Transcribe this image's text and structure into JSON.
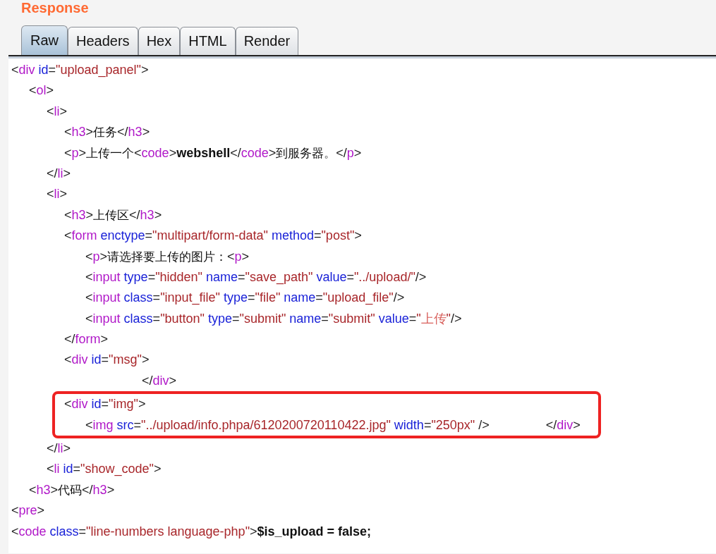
{
  "title": "Response",
  "tabs": [
    {
      "label": "Raw",
      "selected": true
    },
    {
      "label": "Headers",
      "selected": false
    },
    {
      "label": "Hex",
      "selected": false
    },
    {
      "label": "HTML",
      "selected": false
    },
    {
      "label": "Render",
      "selected": false
    }
  ],
  "code_lines": [
    {
      "highlighted": false,
      "segments": [
        {
          "kind": "p",
          "text": "<"
        },
        {
          "kind": "tag",
          "text": "div"
        },
        {
          "kind": "attr",
          "text": " id"
        },
        {
          "kind": "p",
          "text": "="
        },
        {
          "kind": "val",
          "text": "\"upload_panel\""
        },
        {
          "kind": "p",
          "text": ">"
        }
      ]
    },
    {
      "highlighted": false,
      "segments": [
        {
          "kind": "p",
          "text": "     <"
        },
        {
          "kind": "tag",
          "text": "ol"
        },
        {
          "kind": "p",
          "text": ">"
        }
      ]
    },
    {
      "highlighted": false,
      "segments": [
        {
          "kind": "p",
          "text": "          <"
        },
        {
          "kind": "tag",
          "text": "li"
        },
        {
          "kind": "p",
          "text": ">"
        }
      ]
    },
    {
      "highlighted": false,
      "segments": [
        {
          "kind": "p",
          "text": "               <"
        },
        {
          "kind": "tag",
          "text": "h3"
        },
        {
          "kind": "p",
          "text": ">"
        },
        {
          "kind": "text",
          "text": "任务"
        },
        {
          "kind": "p",
          "text": "</"
        },
        {
          "kind": "tag",
          "text": "h3"
        },
        {
          "kind": "p",
          "text": ">"
        }
      ]
    },
    {
      "highlighted": false,
      "segments": [
        {
          "kind": "p",
          "text": "               <"
        },
        {
          "kind": "tag",
          "text": "p"
        },
        {
          "kind": "p",
          "text": ">"
        },
        {
          "kind": "text",
          "text": "上传一个"
        },
        {
          "kind": "p",
          "text": "<"
        },
        {
          "kind": "tag",
          "text": "code"
        },
        {
          "kind": "p",
          "text": ">"
        },
        {
          "kind": "bold",
          "text": "webshell"
        },
        {
          "kind": "p",
          "text": "</"
        },
        {
          "kind": "tag",
          "text": "code"
        },
        {
          "kind": "p",
          "text": ">"
        },
        {
          "kind": "text",
          "text": "到服务器。"
        },
        {
          "kind": "p",
          "text": "</"
        },
        {
          "kind": "tag",
          "text": "p"
        },
        {
          "kind": "p",
          "text": ">"
        }
      ]
    },
    {
      "highlighted": false,
      "segments": [
        {
          "kind": "p",
          "text": "          </"
        },
        {
          "kind": "tag",
          "text": "li"
        },
        {
          "kind": "p",
          "text": ">"
        }
      ]
    },
    {
      "highlighted": false,
      "segments": [
        {
          "kind": "p",
          "text": "          <"
        },
        {
          "kind": "tag",
          "text": "li"
        },
        {
          "kind": "p",
          "text": ">"
        }
      ]
    },
    {
      "highlighted": false,
      "segments": [
        {
          "kind": "p",
          "text": "               <"
        },
        {
          "kind": "tag",
          "text": "h3"
        },
        {
          "kind": "p",
          "text": ">"
        },
        {
          "kind": "text",
          "text": "上传区"
        },
        {
          "kind": "p",
          "text": "</"
        },
        {
          "kind": "tag",
          "text": "h3"
        },
        {
          "kind": "p",
          "text": ">"
        }
      ]
    },
    {
      "highlighted": false,
      "segments": [
        {
          "kind": "p",
          "text": "               <"
        },
        {
          "kind": "tag",
          "text": "form"
        },
        {
          "kind": "attr",
          "text": " enctype"
        },
        {
          "kind": "p",
          "text": "="
        },
        {
          "kind": "val",
          "text": "\"multipart/form-data\""
        },
        {
          "kind": "attr",
          "text": " method"
        },
        {
          "kind": "p",
          "text": "="
        },
        {
          "kind": "val",
          "text": "\"post\""
        },
        {
          "kind": "p",
          "text": ">"
        }
      ]
    },
    {
      "highlighted": false,
      "segments": [
        {
          "kind": "p",
          "text": "                     <"
        },
        {
          "kind": "tag",
          "text": "p"
        },
        {
          "kind": "p",
          "text": ">"
        },
        {
          "kind": "text",
          "text": "请选择要上传的图片："
        },
        {
          "kind": "p",
          "text": "<"
        },
        {
          "kind": "tag",
          "text": "p"
        },
        {
          "kind": "p",
          "text": ">"
        }
      ]
    },
    {
      "highlighted": false,
      "segments": [
        {
          "kind": "p",
          "text": "                     <"
        },
        {
          "kind": "tag",
          "text": "input"
        },
        {
          "kind": "attr",
          "text": " type"
        },
        {
          "kind": "p",
          "text": "="
        },
        {
          "kind": "val",
          "text": "\"hidden\""
        },
        {
          "kind": "attr",
          "text": " name"
        },
        {
          "kind": "p",
          "text": "="
        },
        {
          "kind": "val",
          "text": "\"save_path\""
        },
        {
          "kind": "attr",
          "text": " value"
        },
        {
          "kind": "p",
          "text": "="
        },
        {
          "kind": "val",
          "text": "\"../upload/\""
        },
        {
          "kind": "p",
          "text": "/>"
        }
      ]
    },
    {
      "highlighted": false,
      "segments": [
        {
          "kind": "p",
          "text": "                     <"
        },
        {
          "kind": "tag",
          "text": "input"
        },
        {
          "kind": "attr",
          "text": " class"
        },
        {
          "kind": "p",
          "text": "="
        },
        {
          "kind": "val",
          "text": "\"input_file\""
        },
        {
          "kind": "attr",
          "text": " type"
        },
        {
          "kind": "p",
          "text": "="
        },
        {
          "kind": "val",
          "text": "\"file\""
        },
        {
          "kind": "attr",
          "text": " name"
        },
        {
          "kind": "p",
          "text": "="
        },
        {
          "kind": "val",
          "text": "\"upload_file\""
        },
        {
          "kind": "p",
          "text": "/>"
        }
      ]
    },
    {
      "highlighted": false,
      "segments": [
        {
          "kind": "p",
          "text": "                     <"
        },
        {
          "kind": "tag",
          "text": "input"
        },
        {
          "kind": "attr",
          "text": " class"
        },
        {
          "kind": "p",
          "text": "="
        },
        {
          "kind": "val",
          "text": "\"button\""
        },
        {
          "kind": "attr",
          "text": " type"
        },
        {
          "kind": "p",
          "text": "="
        },
        {
          "kind": "val",
          "text": "\"submit\""
        },
        {
          "kind": "attr",
          "text": " name"
        },
        {
          "kind": "p",
          "text": "="
        },
        {
          "kind": "val",
          "text": "\"submit\""
        },
        {
          "kind": "attr",
          "text": " value"
        },
        {
          "kind": "p",
          "text": "="
        },
        {
          "kind": "val",
          "text": "\""
        },
        {
          "kind": "val2",
          "text": "上传"
        },
        {
          "kind": "val",
          "text": "\""
        },
        {
          "kind": "p",
          "text": "/>"
        }
      ]
    },
    {
      "highlighted": false,
      "segments": [
        {
          "kind": "p",
          "text": "               </"
        },
        {
          "kind": "tag",
          "text": "form"
        },
        {
          "kind": "p",
          "text": ">"
        }
      ]
    },
    {
      "highlighted": false,
      "segments": [
        {
          "kind": "p",
          "text": "               <"
        },
        {
          "kind": "tag",
          "text": "div"
        },
        {
          "kind": "attr",
          "text": " id"
        },
        {
          "kind": "p",
          "text": "="
        },
        {
          "kind": "val",
          "text": "\"msg\""
        },
        {
          "kind": "p",
          "text": ">"
        }
      ]
    },
    {
      "highlighted": false,
      "segments": [
        {
          "kind": "p",
          "text": "                                     </"
        },
        {
          "kind": "tag",
          "text": "div"
        },
        {
          "kind": "p",
          "text": ">"
        }
      ]
    },
    {
      "highlighted": true,
      "segments": [
        {
          "kind": "p",
          "text": "               <"
        },
        {
          "kind": "tag",
          "text": "div"
        },
        {
          "kind": "attr",
          "text": " id"
        },
        {
          "kind": "p",
          "text": "="
        },
        {
          "kind": "val",
          "text": "\"img\""
        },
        {
          "kind": "p",
          "text": ">"
        }
      ]
    },
    {
      "highlighted": true,
      "segments": [
        {
          "kind": "p",
          "text": "                     <"
        },
        {
          "kind": "tag",
          "text": "img"
        },
        {
          "kind": "attr",
          "text": " src"
        },
        {
          "kind": "p",
          "text": "="
        },
        {
          "kind": "val",
          "text": "\"../upload/info.phpa/6120200720110422.jpg\""
        },
        {
          "kind": "attr",
          "text": " width"
        },
        {
          "kind": "p",
          "text": "="
        },
        {
          "kind": "val",
          "text": "\"250px\""
        },
        {
          "kind": "p",
          "text": " />                </"
        },
        {
          "kind": "tag",
          "text": "div"
        },
        {
          "kind": "p",
          "text": ">"
        }
      ]
    },
    {
      "highlighted": false,
      "segments": [
        {
          "kind": "p",
          "text": "          </"
        },
        {
          "kind": "tag",
          "text": "li"
        },
        {
          "kind": "p",
          "text": ">"
        }
      ]
    },
    {
      "highlighted": false,
      "segments": [
        {
          "kind": "p",
          "text": "          <"
        },
        {
          "kind": "tag",
          "text": "li"
        },
        {
          "kind": "attr",
          "text": " id"
        },
        {
          "kind": "p",
          "text": "="
        },
        {
          "kind": "val",
          "text": "\"show_code\""
        },
        {
          "kind": "p",
          "text": ">"
        }
      ]
    },
    {
      "highlighted": false,
      "segments": [
        {
          "kind": "p",
          "text": "     <"
        },
        {
          "kind": "tag",
          "text": "h3"
        },
        {
          "kind": "p",
          "text": ">"
        },
        {
          "kind": "text",
          "text": "代码"
        },
        {
          "kind": "p",
          "text": "</"
        },
        {
          "kind": "tag",
          "text": "h3"
        },
        {
          "kind": "p",
          "text": ">"
        }
      ]
    },
    {
      "highlighted": false,
      "segments": [
        {
          "kind": "p",
          "text": "<"
        },
        {
          "kind": "tag",
          "text": "pre"
        },
        {
          "kind": "p",
          "text": ">"
        }
      ]
    },
    {
      "highlighted": false,
      "segments": [
        {
          "kind": "p",
          "text": "<"
        },
        {
          "kind": "tag",
          "text": "code"
        },
        {
          "kind": "attr",
          "text": " class"
        },
        {
          "kind": "p",
          "text": "="
        },
        {
          "kind": "val",
          "text": "\"line-numbers language-php\""
        },
        {
          "kind": "p",
          "text": ">"
        },
        {
          "kind": "bold",
          "text": "$is_upload = false;"
        }
      ]
    }
  ]
}
